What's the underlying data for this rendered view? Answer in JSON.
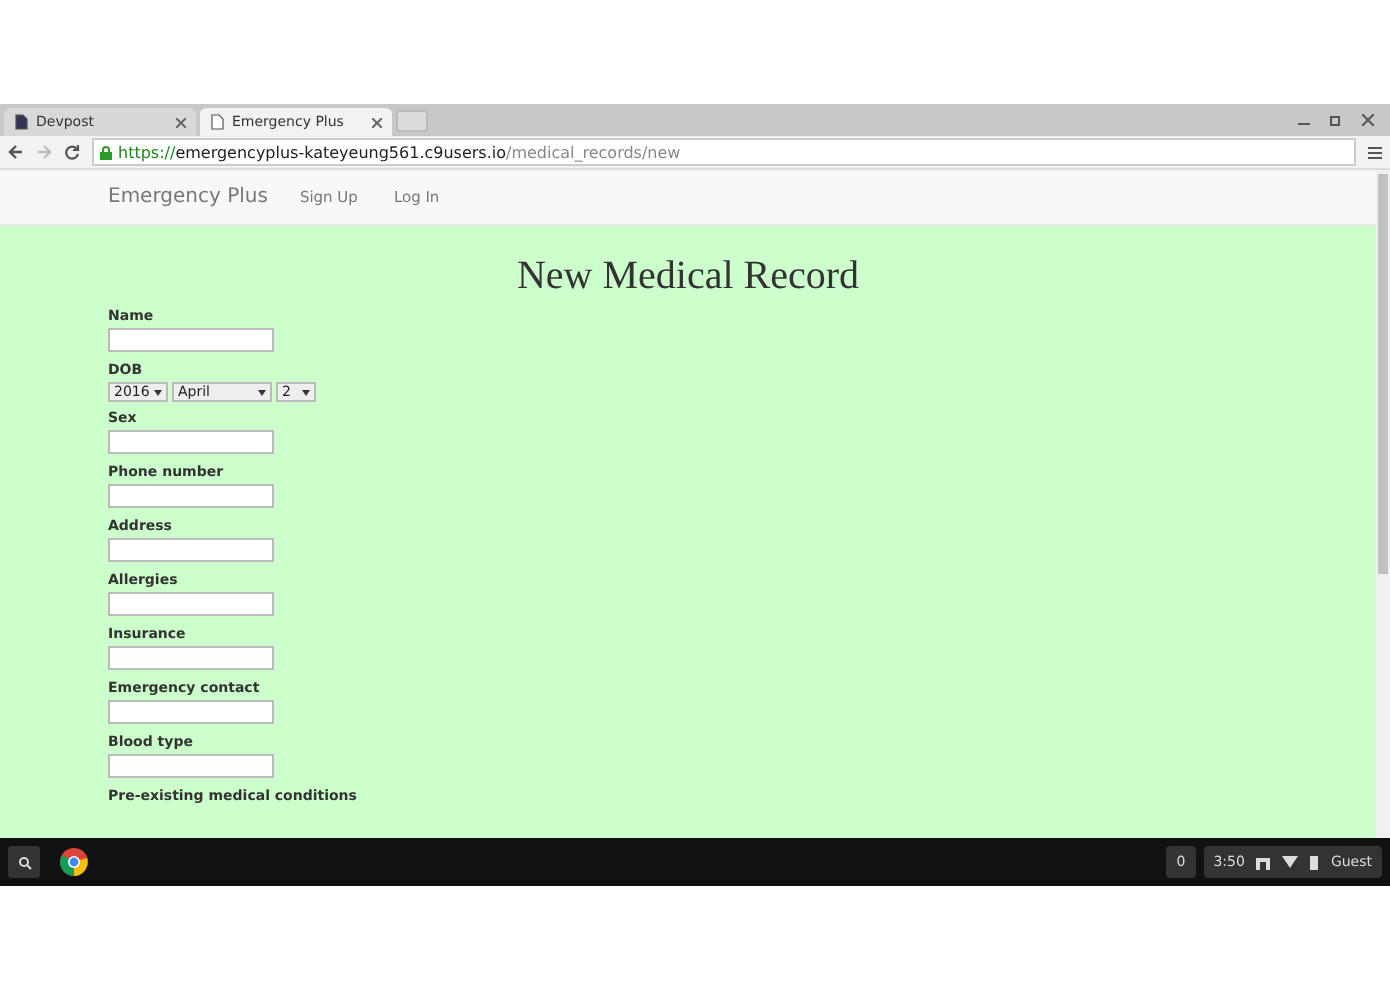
{
  "tabs": [
    {
      "title": "Devpost",
      "selected": false
    },
    {
      "title": "Emergency Plus",
      "selected": true
    }
  ],
  "address_bar": {
    "scheme": "https://",
    "host": "emergencyplus-kateyeung561.c9users.io",
    "path": "/medical_records/new"
  },
  "navbar": {
    "brand": "Emergency Plus",
    "links": [
      "Sign Up",
      "Log In"
    ]
  },
  "page": {
    "heading": "New Medical Record",
    "fields": [
      {
        "kind": "text",
        "label": "Name"
      },
      {
        "kind": "date",
        "label": "DOB",
        "selects": [
          {
            "value": "2016"
          },
          {
            "value": "April"
          },
          {
            "value": "2"
          }
        ]
      },
      {
        "kind": "text",
        "label": "Sex"
      },
      {
        "kind": "text",
        "label": "Phone number"
      },
      {
        "kind": "text",
        "label": "Address"
      },
      {
        "kind": "text",
        "label": "Allergies"
      },
      {
        "kind": "text",
        "label": "Insurance"
      },
      {
        "kind": "text",
        "label": "Emergency contact"
      },
      {
        "kind": "text",
        "label": "Blood type"
      },
      {
        "kind": "label",
        "label": "Pre-existing medical conditions"
      }
    ]
  },
  "taskbar": {
    "notifications": "0",
    "time": "3:50",
    "user": "Guest"
  }
}
